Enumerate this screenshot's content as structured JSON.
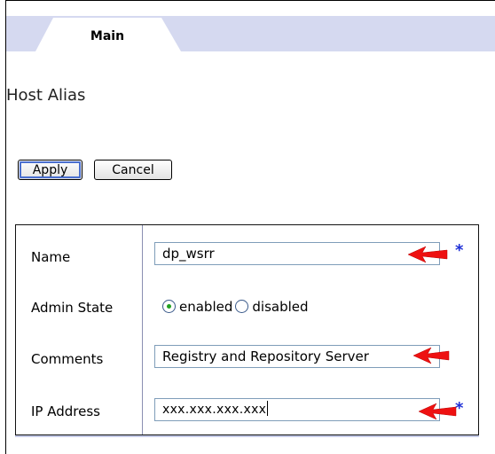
{
  "tabs": [
    {
      "label": "Main"
    }
  ],
  "page": {
    "title": "Host Alias"
  },
  "toolbar": {
    "apply_label": "Apply",
    "cancel_label": "Cancel"
  },
  "form": {
    "name": {
      "label": "Name",
      "value": "dp_wsrr",
      "required_mark": "*"
    },
    "admin_state": {
      "label": "Admin State",
      "options": [
        "enabled",
        "disabled"
      ],
      "selected": "enabled"
    },
    "comments": {
      "label": "Comments",
      "value": "Registry and Repository Server"
    },
    "ip_address": {
      "label": "IP Address",
      "value": "xxx.xxx.xxx.xxx",
      "required_mark": "*"
    }
  },
  "colors": {
    "tab_bar": "#d5d9f0",
    "required_mark": "#1e2fd6",
    "annotation_arrow": "#ee1111",
    "radio_selected": "#21a121"
  },
  "icons": [
    "red-arrow-annotation-icon",
    "radio-selected-icon",
    "radio-unselected-icon"
  ]
}
